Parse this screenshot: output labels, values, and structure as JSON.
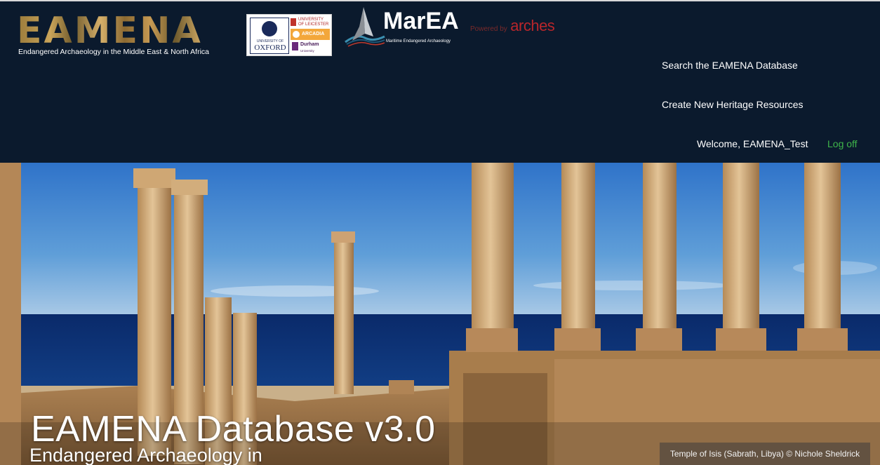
{
  "header": {
    "eamena_logo": {
      "word": "EAMENA",
      "tagline": "Endangered Archaeology in the Middle East & North Africa"
    },
    "partners": {
      "oxford_small": "UNIVERSITY OF",
      "oxford_big": "OXFORD",
      "leicester": "UNIVERSITY OF LEICESTER",
      "arcadia": "ARCADIA",
      "durham": "Durham",
      "durham_sub": "University"
    },
    "marea_logo": {
      "word": "MarEA",
      "subtitle": "Maritime Endangered Archaeology"
    },
    "powered_by": {
      "prefix": "Powered by",
      "name": "arches"
    }
  },
  "nav": {
    "search_label": "Search the EAMENA Database",
    "create_label": "Create New Heritage Resources",
    "welcome_text": "Welcome, EAMENA_Test",
    "logoff_label": "Log off"
  },
  "hero": {
    "title": "EAMENA Database v3.0",
    "subtitle": "Endangered Archaeology in",
    "photo_credit": "Temple of Isis (Sabrath, Libya) © Nichole Sheldrick"
  },
  "colors": {
    "header_bg": "#0b1a2d",
    "logoff_green": "#3fb54a",
    "arches_red": "#b8262b"
  }
}
